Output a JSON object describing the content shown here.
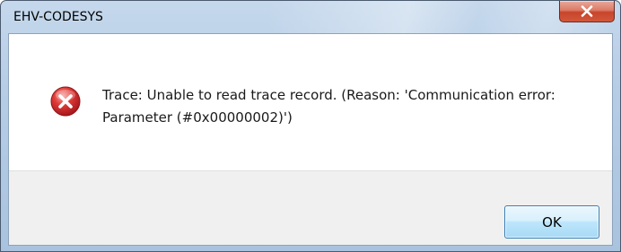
{
  "window": {
    "title": "EHV-CODESYS",
    "close_icon": "close-icon"
  },
  "message": {
    "icon": "error-icon",
    "text": "Trace: Unable to read trace record. (Reason: 'Communication error: Parameter (#0x00000002)')"
  },
  "buttons": {
    "ok_label": "OK"
  },
  "colors": {
    "error_icon": "#c8232b",
    "close_button": "#c7442b",
    "footer_bg": "#f0f0f0"
  }
}
